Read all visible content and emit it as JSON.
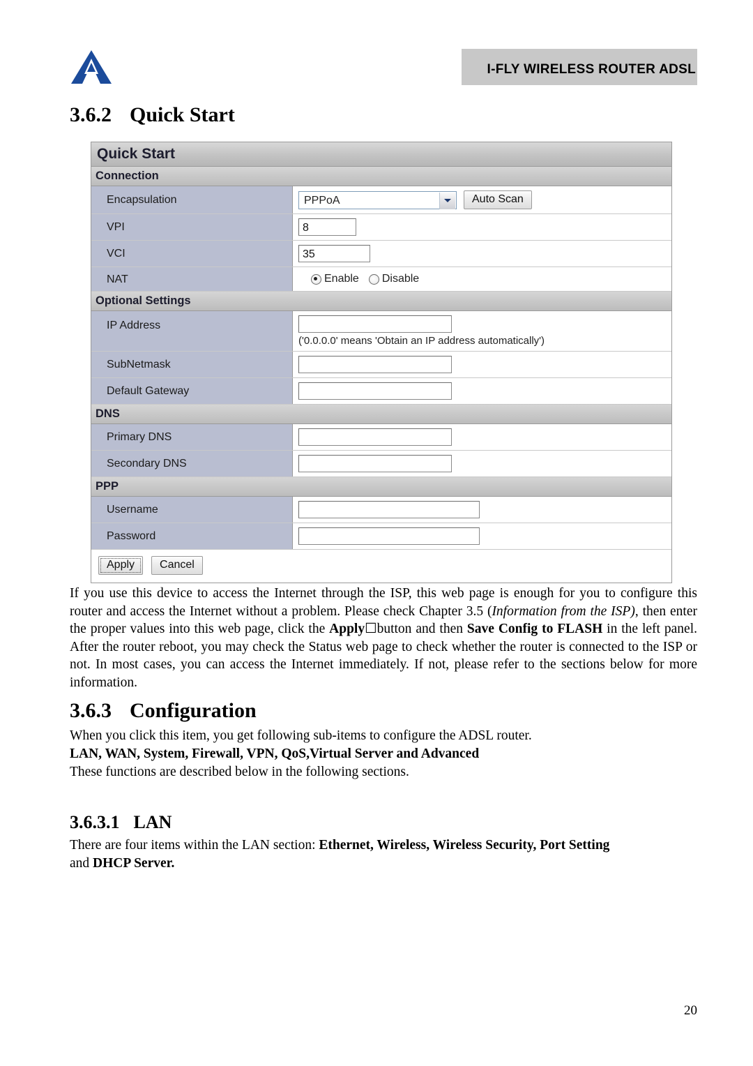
{
  "header": {
    "title": "I-FLY WIRELESS ROUTER ADSL"
  },
  "sections": {
    "quick_start": {
      "number": "3.6.2",
      "title": "Quick Start"
    },
    "configuration": {
      "number": "3.6.3",
      "title": "Configuration"
    },
    "lan": {
      "number": "3.6.3.1",
      "title": "LAN"
    }
  },
  "screenshot": {
    "panel_title": "Quick Start",
    "connection": {
      "heading": "Connection",
      "encapsulation_label": "Encapsulation",
      "encapsulation_value": "PPPoA",
      "auto_scan_button": "Auto Scan",
      "vpi_label": "VPI",
      "vpi_value": "8",
      "vci_label": "VCI",
      "vci_value": "35",
      "nat_label": "NAT",
      "nat_enable": "Enable",
      "nat_disable": "Disable"
    },
    "optional": {
      "heading": "Optional Settings",
      "ip_address_label": "IP Address",
      "ip_address_value": "",
      "ip_address_hint": "('0.0.0.0' means 'Obtain an IP address automatically')",
      "subnetmask_label": "SubNetmask",
      "subnetmask_value": "",
      "default_gateway_label": "Default Gateway",
      "default_gateway_value": ""
    },
    "dns": {
      "heading": "DNS",
      "primary_label": "Primary DNS",
      "primary_value": "",
      "secondary_label": "Secondary DNS",
      "secondary_value": ""
    },
    "ppp": {
      "heading": "PPP",
      "username_label": "Username",
      "username_value": "",
      "password_label": "Password",
      "password_value": ""
    },
    "apply_button": "Apply",
    "cancel_button": "Cancel"
  },
  "body": {
    "quick_start_para_1": "If you use this device to access the Internet through the ISP, this web page is enough for you to configure this router and access the Internet without a problem. Please check Chapter 3.5 (",
    "quick_start_para_italic": "Information from the ISP)",
    "quick_start_para_2": ", then enter the proper values into this web page, click the ",
    "quick_start_apply_bold": "Apply",
    "quick_start_para_3": "button and then ",
    "quick_start_save_bold": "Save Config to FLASH",
    "quick_start_para_4": " in the left panel. After the router reboot, you may check the Status web page to check whether the router is connected to the ISP or not. In most cases, you can access the Internet immediately.  If not, please refer to the sections below for more information.",
    "configuration_para": "When you click this item, you get following sub-items to configure the ADSL router.",
    "configuration_subitems_bold": "LAN, WAN, System, Firewall, VPN, QoS,Virtual Server and Advanced",
    "configuration_para_2": "These functions are described below in the following sections.",
    "lan_para_1": "There are four items within the LAN section: ",
    "lan_items_bold": "Ethernet, Wireless, Wireless Security, Port Setting",
    "lan_para_2": "and ",
    "lan_items_bold_2": "DHCP Server."
  },
  "page_number": "20"
}
